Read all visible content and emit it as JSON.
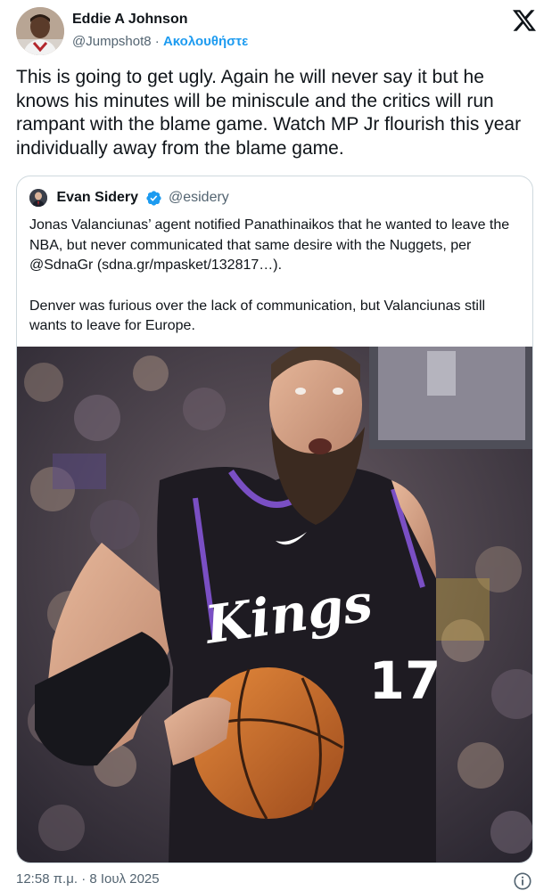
{
  "author": {
    "name": "Eddie A Johnson",
    "handle": "@Jumpshot8",
    "separator": "·",
    "follow_label": "Ακολουθήστε"
  },
  "tweet": {
    "text": "This is going to get ugly.  Again he will never say it but he knows his minutes will be miniscule and the critics will run rampant with the blame game. Watch MP Jr flourish this year individually away from the blame game."
  },
  "quoted": {
    "name": "Evan Sidery",
    "handle": "@esidery",
    "paragraph1": "Jonas Valanciunas’ agent notified Panathinaikos that he wanted to leave the NBA, but never communicated that same desire with the Nuggets, per @SdnaGr (sdna.gr/mpasket/132817…).",
    "paragraph2": "Denver was furious over the lack of communication, but Valanciunas still wants to leave for Europe.",
    "photo": {
      "jersey_wordmark": "Kings",
      "jersey_number": "17"
    }
  },
  "footer": {
    "timestamp": "12:58 π.μ. · 8 Ιουλ 2025"
  },
  "colors": {
    "accent": "#1d9bf0",
    "secondary_text": "#536471",
    "border": "#cfd9de"
  },
  "icons": {
    "logo": "x-logo-icon",
    "verified": "verified-badge-icon",
    "info": "info-icon"
  }
}
